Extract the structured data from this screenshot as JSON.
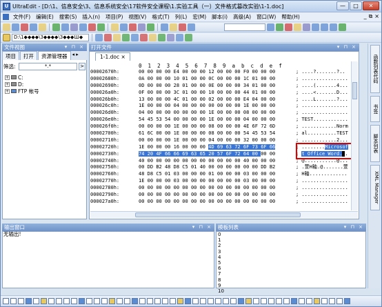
{
  "window": {
    "title": "UltraEdit - [D:\\1、信息安全\\3、信息系统安全\\17软件安全课程\\1.实验工具（一）文件格式篡改实验\\1-1.doc]",
    "min": "—",
    "max": "□",
    "close": "✕"
  },
  "menu": [
    "文件(F)",
    "编辑(E)",
    "搜索(S)",
    "插入(n)",
    "项目(P)",
    "视图(V)",
    "格式(T)",
    "列(L)",
    "宏(M)",
    "脚本(i)",
    "高级(A)",
    "窗口(W)",
    "帮助(H)"
  ],
  "mdi": {
    "min": "_",
    "restore": "⧉",
    "close": "×"
  },
  "toolbar2_path": "D:\\1◆◆◆◆\\3◆◆◆◆\\3◆◆◆Ш◆",
  "left_panel": {
    "header": "文件视图",
    "tabs": [
      "项目",
      "打开",
      "资源管理器"
    ],
    "filter_label": "筛选:",
    "filter_value": "*.*",
    "tree": [
      "C:",
      "D:",
      "FTP 帐号"
    ]
  },
  "editor": {
    "header": "打开文件",
    "tab_label": "1-1.doc",
    "ruler": "0  1  2  3  4  5  6  7  8  9  a  b  c  d  e  f",
    "rows": [
      {
        "addr": "00002670h:",
        "bytes": "00 00 00 00 E4 00 00 00 12 00 00 00 F0 00 00 00",
        "ascii": "; ....?.......?.."
      },
      {
        "addr": "00002680h:",
        "bytes": "0A 00 00 00 10 01 00 00 0C 00 00 00 1C 01 00 00",
        "ascii": "; ................"
      },
      {
        "addr": "00002690h:",
        "bytes": "0D 00 00 00 28 01 00 00 0E 00 00 00 34 01 00 00",
        "ascii": "; ....(.......4..."
      },
      {
        "addr": "000026a0h:",
        "bytes": "0F 00 00 00 3C 01 00 00 10 00 00 00 44 01 00 00",
        "ascii": "; ....<.......D..."
      },
      {
        "addr": "000026b0h:",
        "bytes": "13 00 00 00 4C 01 00 00 02 00 00 00 E4 04 00 00",
        "ascii": "; ....L.......?..."
      },
      {
        "addr": "000026c0h:",
        "bytes": "1E 00 00 00 04 00 00 00 00 00 00 00 1E 00 00 00",
        "ascii": "; ................"
      },
      {
        "addr": "000026d0h:",
        "bytes": "04 00 00 00 00 00 00 00 1E 00 00 00 08 00 00 00",
        "ascii": "; ................"
      },
      {
        "addr": "000026e0h:",
        "bytes": "54 45 53 54 00 00 00 00 1E 00 00 00 04 00 00 00",
        "ascii": "; TEST............"
      },
      {
        "addr": "000026f0h:",
        "bytes": "00 00 00 00 1E 00 00 00 08 00 00 00 4E 6F 72 6D",
        "ascii": "; ............Norm"
      },
      {
        "addr": "00002700h:",
        "bytes": "61 6C 00 00 1E 00 00 00 08 00 00 00 54 45 53 54",
        "ascii": "; al..........TEST"
      },
      {
        "addr": "00002710h:",
        "bytes": "00 00 00 00 1E 00 00 00 04 00 00 00 32 00 00 00",
        "ascii": "; ............2..."
      },
      {
        "addr": "00002720h:",
        "bytes": "1E 00 00 00 16 00 00 00 4D 69 63 72 6F 73 6F 66",
        "ascii": "; ........Microsof",
        "hl_from": 8
      },
      {
        "addr": "00002730h:",
        "bytes": "74 20 4F 66 66 69 63 65 20 57 6F 72 64 00 00 00",
        "ascii": "; t Office Word...",
        "hl_to": 13
      },
      {
        "addr": "00002740h:",
        "bytes": "40 00 00 00 00 00 00 00 00 00 00 00 40 00 00 00",
        "ascii": "; @...........@..."
      },
      {
        "addr": "00002750h:",
        "bytes": "00 DD B2 48 D8 C5 01 40 00 00 00 00 00 00 DD B2",
        "ascii": "; .萱H釉.@.......萱"
      },
      {
        "addr": "00002760h:",
        "bytes": "48 D8 C5 01 03 00 00 00 01 00 00 00 03 00 00 00",
        "ascii": "; H釉............."
      },
      {
        "addr": "00002770h:",
        "bytes": "1E 00 00 00 03 00 00 00 00 00 00 00 03 00 00 00",
        "ascii": "; ................"
      },
      {
        "addr": "00002780h:",
        "bytes": "00 00 00 00 00 00 00 00 00 00 00 00 00 00 00 00",
        "ascii": "; ................"
      },
      {
        "addr": "00002790h:",
        "bytes": "00 00 00 00 00 00 00 00 00 00 00 00 00 00 00 00",
        "ascii": "; ................"
      },
      {
        "addr": "000027a0h:",
        "bytes": "00 00 00 00 00 00 00 00 00 00 00 00 00 00 00 00",
        "ascii": "; ................"
      }
    ]
  },
  "right_tabs": [
    "函数列表代码",
    "书签",
    "脚本列表",
    "XML Manager"
  ],
  "output": {
    "header": "输出窗口",
    "text": "无输出!"
  },
  "templates": {
    "header": "模板列表",
    "items": [
      "0",
      "1",
      "2",
      "3",
      "4",
      "5",
      "6",
      "7",
      "8",
      "9",
      "10"
    ]
  },
  "colors": {
    "highlight": "#3875d7",
    "redbox": "#e00000",
    "pane_header": "#7a9dd0"
  }
}
